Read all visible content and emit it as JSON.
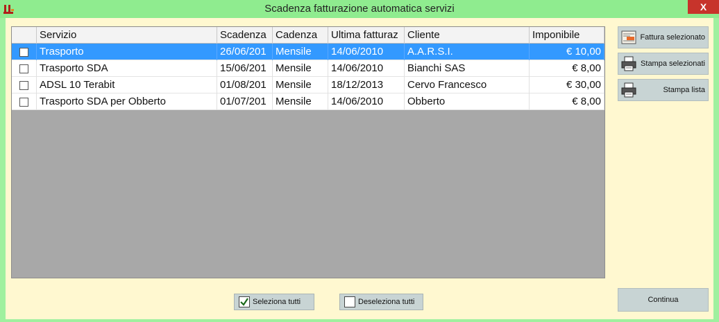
{
  "window": {
    "title": "Scadenza fatturazione automatica servizi",
    "close_glyph": "X",
    "icon": "app-logo-icon"
  },
  "colors": {
    "titlebar": "#8fec8f",
    "background": "#fff8d0",
    "selection": "#3399ff",
    "grid_empty": "#a8a8a8",
    "button": "#c8d4d4"
  },
  "grid": {
    "columns": [
      "",
      "Servizio",
      "Scadenza",
      "Cadenza",
      "Ultima fatturaz",
      "Cliente",
      "Imponibile"
    ],
    "rows": [
      {
        "checked": false,
        "selected": true,
        "servizio": "Trasporto",
        "scadenza": "26/06/201",
        "cadenza": "Mensile",
        "ultima": "14/06/2010",
        "cliente": "A.A.R.S.I.",
        "imponibile": "€ 10,00"
      },
      {
        "checked": false,
        "selected": false,
        "servizio": "Trasporto SDA",
        "scadenza": "15/06/201",
        "cadenza": "Mensile",
        "ultima": "14/06/2010",
        "cliente": "Bianchi SAS",
        "imponibile": "€ 8,00"
      },
      {
        "checked": false,
        "selected": false,
        "servizio": "ADSL 10 Terabit",
        "scadenza": "01/08/201",
        "cadenza": "Mensile",
        "ultima": "18/12/2013",
        "cliente": "Cervo Francesco",
        "imponibile": "€ 30,00"
      },
      {
        "checked": false,
        "selected": false,
        "servizio": "Trasporto SDA per Obberto",
        "scadenza": "01/07/201",
        "cadenza": "Mensile",
        "ultima": "14/06/2010",
        "cliente": "Obberto",
        "imponibile": "€ 8,00"
      }
    ]
  },
  "side_buttons": {
    "fattura": {
      "label": "Fattura selezionato",
      "icon": "invoice-icon"
    },
    "stampa_sel": {
      "label": "Stampa selezionati",
      "icon": "printer-icon"
    },
    "stampa_lista": {
      "label": "Stampa lista",
      "icon": "printer-icon"
    }
  },
  "bottom": {
    "seleziona": {
      "label": "Seleziona tutti",
      "checked": true
    },
    "deseleziona": {
      "label": "Deseleziona tutti",
      "checked": false
    },
    "continua": "Continua"
  }
}
